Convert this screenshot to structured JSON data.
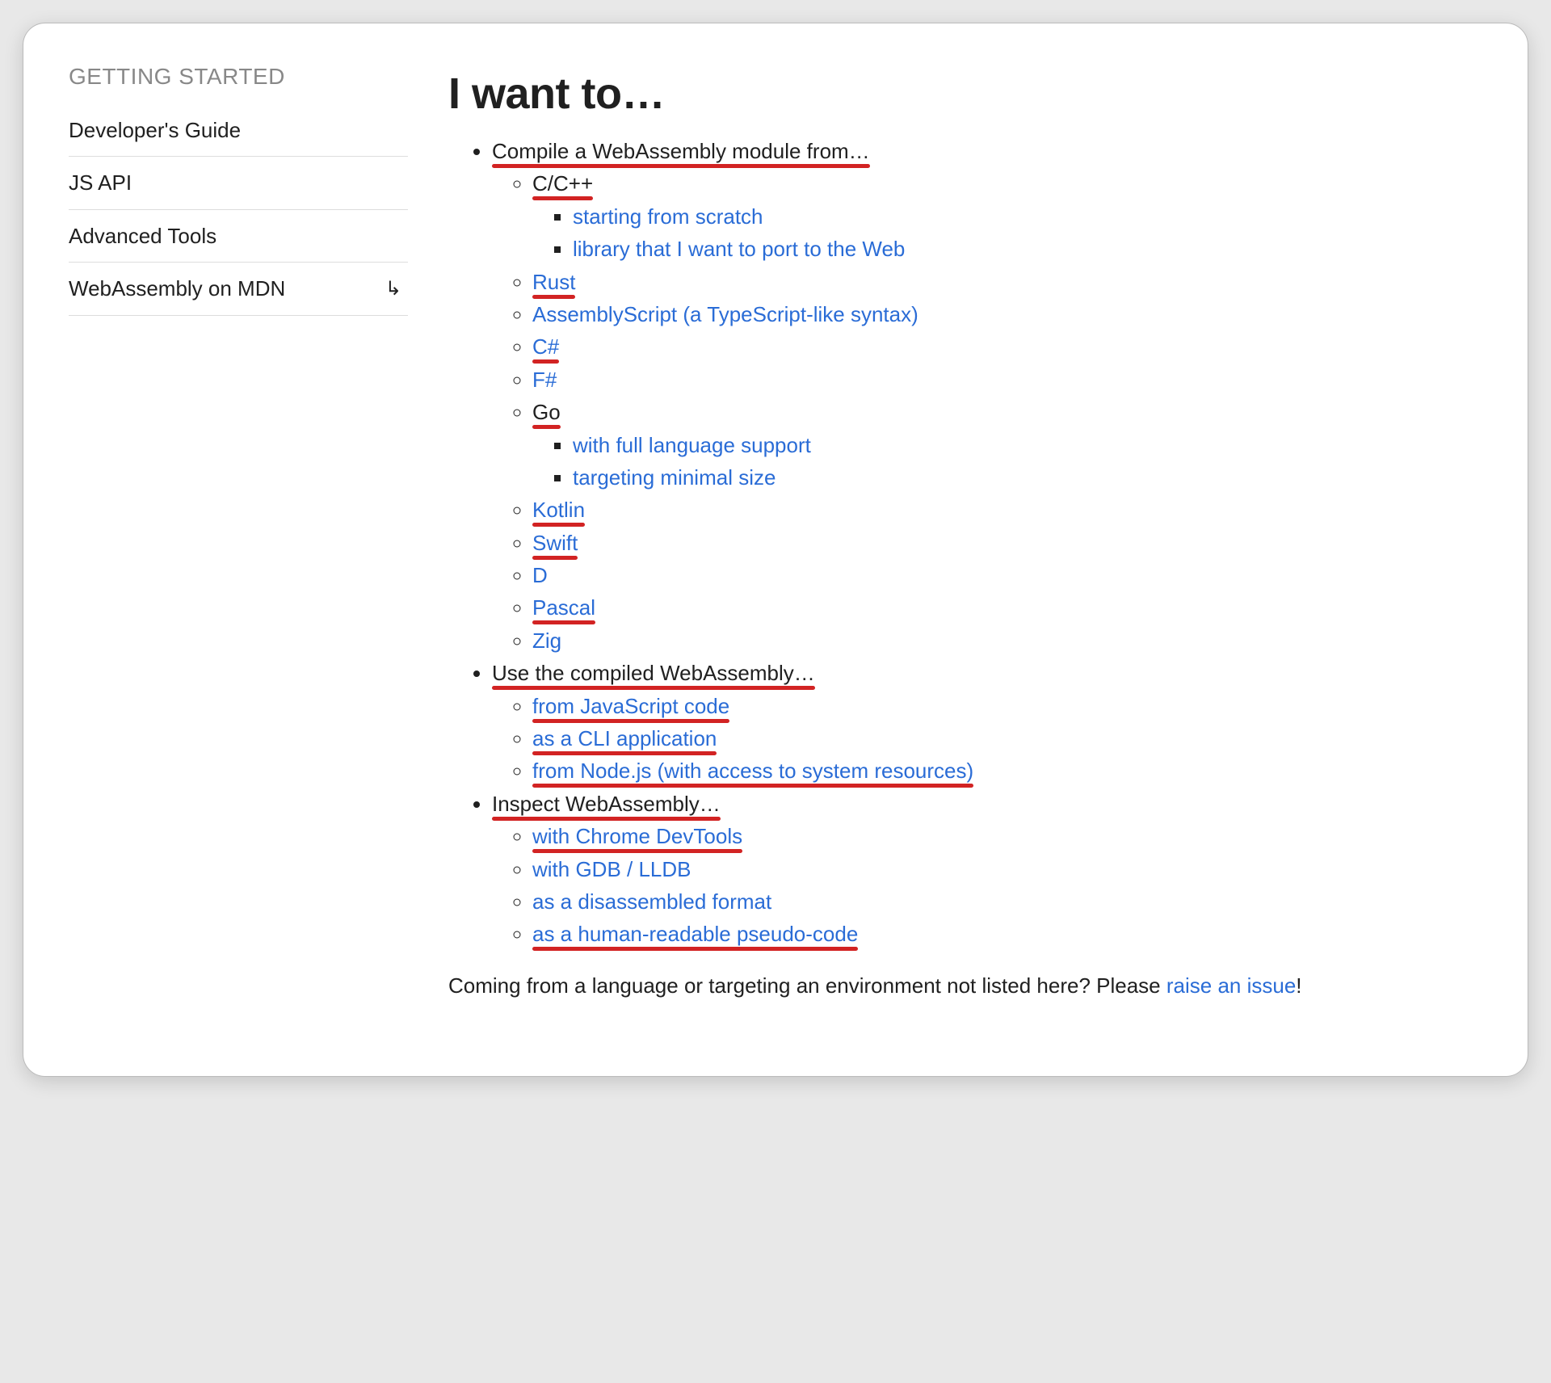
{
  "sidebar": {
    "heading": "GETTING STARTED",
    "items": [
      {
        "label": "Developer's Guide",
        "external": false
      },
      {
        "label": "JS API",
        "external": false
      },
      {
        "label": "Advanced Tools",
        "external": false
      },
      {
        "label": "WebAssembly on MDN",
        "external": true
      }
    ]
  },
  "main": {
    "title": "I want to…",
    "footer_prefix": "Coming from a language or targeting an environment not listed here? Please ",
    "footer_link": "raise an issue",
    "footer_suffix": "!"
  },
  "tree": [
    {
      "label": "Compile a WebAssembly module from…",
      "link": false,
      "red": true,
      "children": [
        {
          "label": "C/C++",
          "link": false,
          "red": true,
          "children": [
            {
              "label": "starting from scratch",
              "link": true,
              "red": false
            },
            {
              "label": "library that I want to port to the Web",
              "link": true,
              "red": false
            }
          ]
        },
        {
          "label": "Rust",
          "link": true,
          "red": true
        },
        {
          "label": "AssemblyScript (a TypeScript-like syntax)",
          "link": true,
          "red": false
        },
        {
          "label": "C#",
          "link": true,
          "red": true
        },
        {
          "label": "F#",
          "link": true,
          "red": false
        },
        {
          "label": "Go",
          "link": false,
          "red": true,
          "children": [
            {
              "label": "with full language support",
              "link": true,
              "red": false
            },
            {
              "label": "targeting minimal size",
              "link": true,
              "red": false
            }
          ]
        },
        {
          "label": "Kotlin",
          "link": true,
          "red": true
        },
        {
          "label": "Swift",
          "link": true,
          "red": true
        },
        {
          "label": "D",
          "link": true,
          "red": false
        },
        {
          "label": "Pascal",
          "link": true,
          "red": true
        },
        {
          "label": "Zig",
          "link": true,
          "red": false
        }
      ]
    },
    {
      "label": "Use the compiled WebAssembly…",
      "link": false,
      "red": true,
      "children": [
        {
          "label": "from JavaScript code",
          "link": true,
          "red": true
        },
        {
          "label": "as a CLI application",
          "link": true,
          "red": true
        },
        {
          "label": "from Node.js (with access to system resources)",
          "link": true,
          "red": true
        }
      ]
    },
    {
      "label": "Inspect WebAssembly…",
      "link": false,
      "red": true,
      "children": [
        {
          "label": "with Chrome DevTools",
          "link": true,
          "red": true
        },
        {
          "label": "with GDB / LLDB",
          "link": true,
          "red": false
        },
        {
          "label": "as a disassembled format",
          "link": true,
          "red": false
        },
        {
          "label": "as a human-readable pseudo-code",
          "link": true,
          "red": true
        }
      ]
    }
  ]
}
